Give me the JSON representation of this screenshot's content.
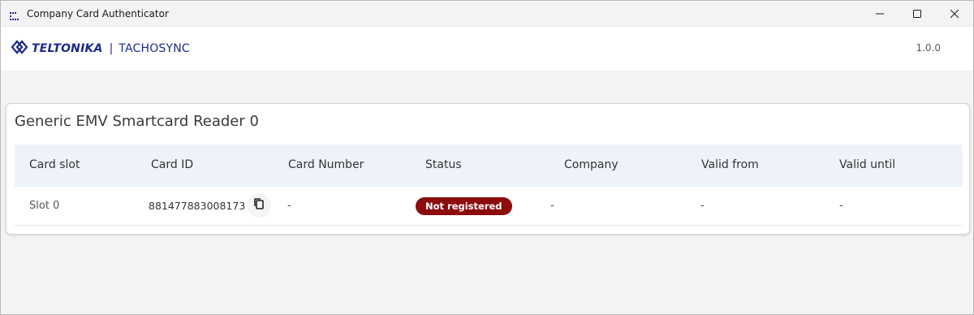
{
  "window": {
    "title": "Company Card Authenticator",
    "app_icon": "app-icon",
    "controls": [
      "minimize-icon",
      "maximize-icon",
      "close-icon"
    ]
  },
  "header": {
    "brand": "TELTONIKA",
    "separator": "|",
    "product": "TACHOSYNC",
    "version": "1.0.0",
    "brand_color": "#1c2b8a"
  },
  "reader": {
    "title": "Generic EMV Smartcard Reader 0",
    "columns": [
      "Card slot",
      "Card ID",
      "Card Number",
      "Status",
      "Company",
      "Valid from",
      "Valid until"
    ],
    "rows": [
      {
        "slot": "Slot 0",
        "card_id": "881477883008173",
        "card_number": "-",
        "status": "Not registered",
        "company": "-",
        "valid_from": "-",
        "valid_until": "-"
      }
    ],
    "copy_icon": "copy-icon",
    "status_color": "#8c0b0b",
    "header_bg": "#eef3fb"
  }
}
